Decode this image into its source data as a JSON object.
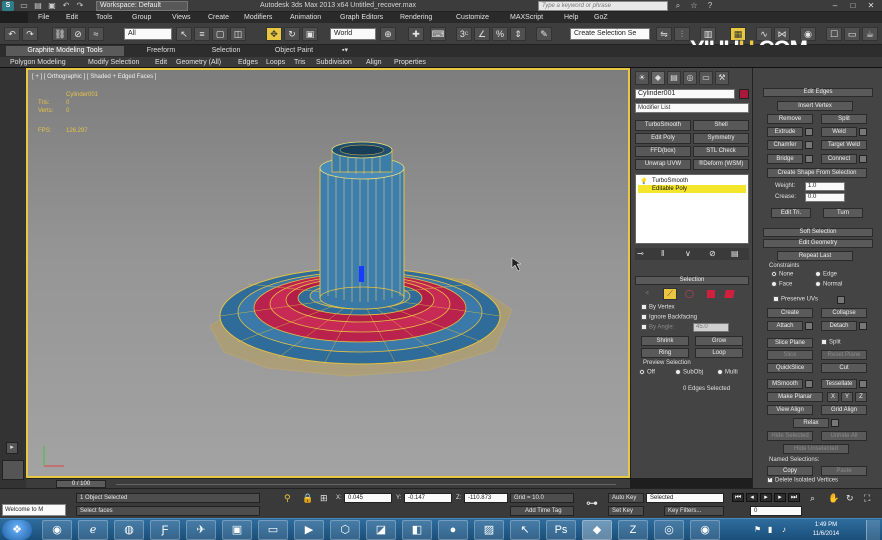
{
  "titlebar": {
    "workspace": "Workspace: Default",
    "title": "Autodesk 3ds Max 2013 x64      Untitled_recover.max",
    "search_placeholder": "Type a keyword or phrase"
  },
  "menu": [
    "File",
    "Edit",
    "Tools",
    "Group",
    "Views",
    "Create",
    "Modifiers",
    "Animation",
    "Graph Editors",
    "Rendering",
    "Customize",
    "MAXScript",
    "Help",
    "GoZ"
  ],
  "toolbar": {
    "filter": "All",
    "coord_system": "World",
    "selection_set": "Create Selection Se"
  },
  "watermark": {
    "prefix": "YIHU",
    "o": "U",
    "suffix": ".COM"
  },
  "ribbon": {
    "tabs": [
      "Graphite Modeling Tools",
      "Freeform",
      "Selection",
      "Object Paint"
    ],
    "items": [
      "Polygon Modeling",
      "Modify Selection",
      "Edit",
      "Geometry (All)",
      "Edges",
      "Loops",
      "Tris",
      "Subdivision",
      "Align",
      "Properties"
    ]
  },
  "viewport": {
    "label": "[ + ] [ Orthographic ] [ Shaded + Edged Faces ]",
    "object_name": "Cylinder001",
    "stats": [
      {
        "label": "Tris:",
        "value": "0"
      },
      {
        "label": "Verts:",
        "value": "0"
      }
    ],
    "fps_label": "FPS:",
    "fps_value": "126.297"
  },
  "command_panel": {
    "object_name": "Cylinder001",
    "color": "#a8183a",
    "modifier_list": "Modifier List",
    "modifier_buttons": [
      [
        "TurboSmooth",
        "Shell"
      ],
      [
        "Edit Poly",
        "Symmetry"
      ],
      [
        "FFD(box)",
        "STL Check"
      ],
      [
        "Unwrap UVW",
        "®Deform (WSM)"
      ]
    ],
    "stack": [
      {
        "label": "TurboSmooth",
        "selected": false
      },
      {
        "label": "Editable Poly",
        "selected": true
      }
    ],
    "selection": {
      "title": "Selection",
      "by_vertex": "By Vertex",
      "ignore_backfacing": "Ignore Backfacing",
      "by_angle": "By Angle:",
      "by_angle_value": "45.0",
      "shrink": "Shrink",
      "grow": "Grow",
      "ring": "Ring",
      "loop": "Loop",
      "preview_title": "Preview Selection",
      "preview_off": "Off",
      "preview_subobj": "SubObj",
      "preview_multi": "Multi",
      "status": "0 Edges Selected"
    }
  },
  "edit_edges": {
    "title": "Edit Edges",
    "insert_vertex": "Insert Vertex",
    "remove": "Remove",
    "split": "Split",
    "extrude": "Extrude",
    "weld": "Weld",
    "chamfer": "Chamfer",
    "target_weld": "Target Weld",
    "bridge": "Bridge",
    "connect": "Connect",
    "create_shape": "Create Shape From Selection",
    "weight_label": "Weight:",
    "weight_value": "1.0",
    "crease_label": "Crease:",
    "crease_value": "0.0",
    "edit_tri": "Edit Tri.",
    "turn": "Turn"
  },
  "soft_selection": {
    "title": "Soft Selection"
  },
  "edit_geometry": {
    "title": "Edit Geometry",
    "repeat_last": "Repeat Last",
    "constraints": "Constraints",
    "none": "None",
    "edge": "Edge",
    "face": "Face",
    "normal": "Normal",
    "preserve_uvs": "Preserve UVs",
    "create": "Create",
    "collapse": "Collapse",
    "attach": "Attach",
    "detach": "Detach",
    "slice_plane": "Slice Plane",
    "split": "Split",
    "slice": "Slice",
    "reset_plane": "Reset Plane",
    "quickslice": "QuickSlice",
    "cut": "Cut",
    "msmooth": "MSmooth",
    "tessellate": "Tessellate",
    "make_planar": "Make Planar",
    "x": "X",
    "y": "Y",
    "z": "Z",
    "view_align": "View Align",
    "grid_align": "Grid Align",
    "relax": "Relax",
    "hide_selected": "Hide Selected",
    "unhide_all": "Unhide All",
    "hide_unselected": "Hide Unselected",
    "named_selections": "Named Selections:",
    "copy": "Copy",
    "paste": "Paste",
    "delete_isolated": "Delete Isolated Vertices"
  },
  "timeline": {
    "slider": "0 / 100"
  },
  "status": {
    "welcome": "Welcome to M",
    "objects_selected": "1 Object Selected",
    "prompt": "Select faces",
    "x_label": "X:",
    "x_value": "0.045",
    "y_label": "Y:",
    "y_value": "-0.147",
    "z_label": "Z:",
    "z_value": "-110.873",
    "grid": "Grid = 10.0",
    "add_time_tag": "Add Time Tag",
    "auto_key": "Auto Key",
    "set_key": "Set Key",
    "selected": "Selected",
    "key_filters": "Key Filters...",
    "frame": "0"
  },
  "taskbar": {
    "time": "1:49 PM",
    "date": "11/6/2014"
  }
}
